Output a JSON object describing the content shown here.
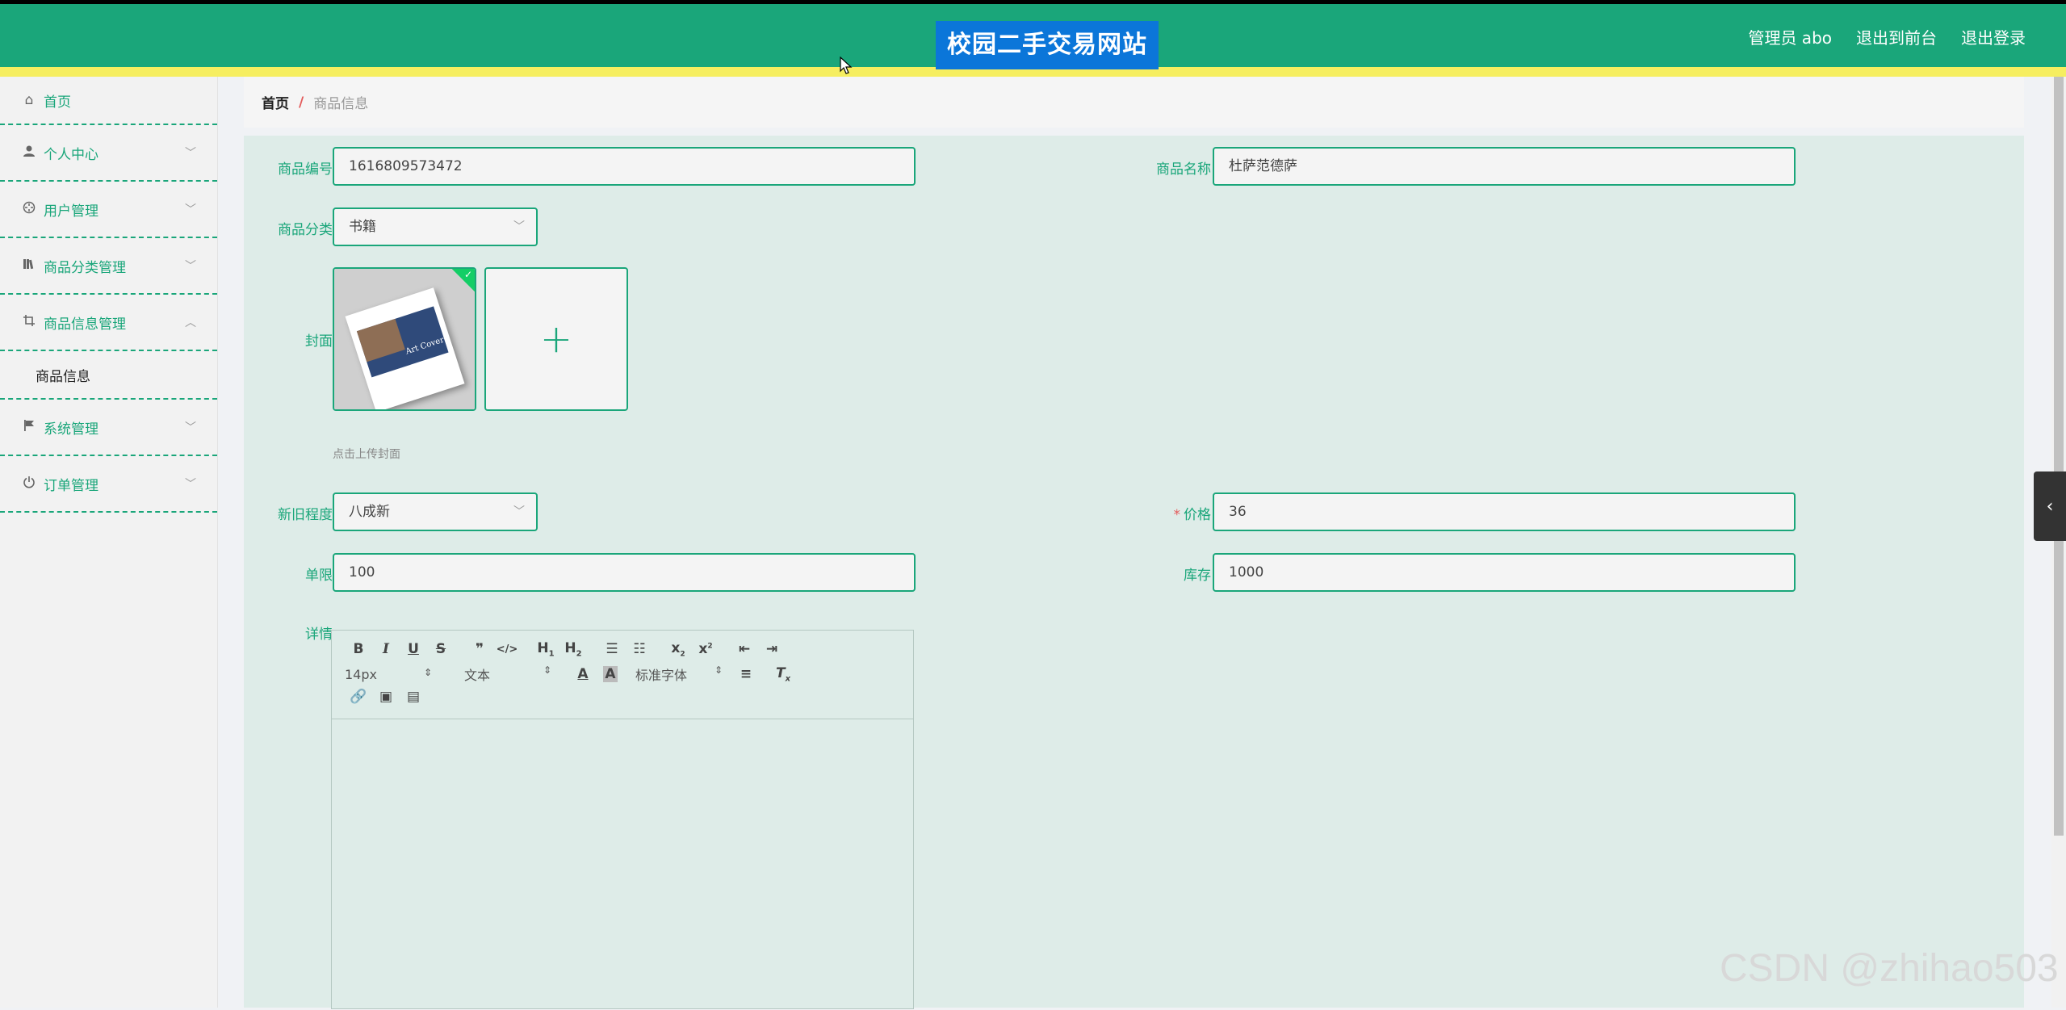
{
  "header": {
    "site_title": "校园二手交易网站",
    "admin_label": "管理员 abo",
    "back_to_front": "退出到前台",
    "logout": "退出登录"
  },
  "colors": {
    "primary": "#1aa67a",
    "accent_line": "#f6ee60",
    "title_bg": "#0b76d9",
    "required": "#e35b5b"
  },
  "sidebar": {
    "items": [
      {
        "label": "首页",
        "icon": "home-icon"
      },
      {
        "label": "个人中心",
        "icon": "user-icon"
      },
      {
        "label": "用户管理",
        "icon": "compass-icon"
      },
      {
        "label": "商品分类管理",
        "icon": "library-icon"
      },
      {
        "label": "商品信息管理",
        "icon": "crop-icon"
      },
      {
        "label": "系统管理",
        "icon": "flag-icon"
      },
      {
        "label": "订单管理",
        "icon": "power-icon"
      }
    ],
    "submenu_item": "商品信息"
  },
  "breadcrumb": {
    "home": "首页",
    "separator": "/",
    "current": "商品信息"
  },
  "form": {
    "product_code": {
      "label": "商品编号",
      "value": "1616809573472"
    },
    "product_name": {
      "label": "商品名称",
      "value": "杜萨范德萨"
    },
    "category": {
      "label": "商品分类",
      "value": "书籍"
    },
    "cover": {
      "label": "封面",
      "hint": "点击上传封面",
      "thumb_text": "Art Cover"
    },
    "condition": {
      "label": "新旧程度",
      "value": "八成新"
    },
    "price": {
      "label": "价格",
      "required_mark": "*",
      "value": "36"
    },
    "limit": {
      "label": "单限",
      "value": "100"
    },
    "stock": {
      "label": "库存",
      "value": "1000"
    },
    "details": {
      "label": "详情"
    }
  },
  "editor": {
    "font_size": "14px",
    "block_type": "文本",
    "font_family": "标准字体"
  },
  "watermark": "CSDN @zhihao503"
}
